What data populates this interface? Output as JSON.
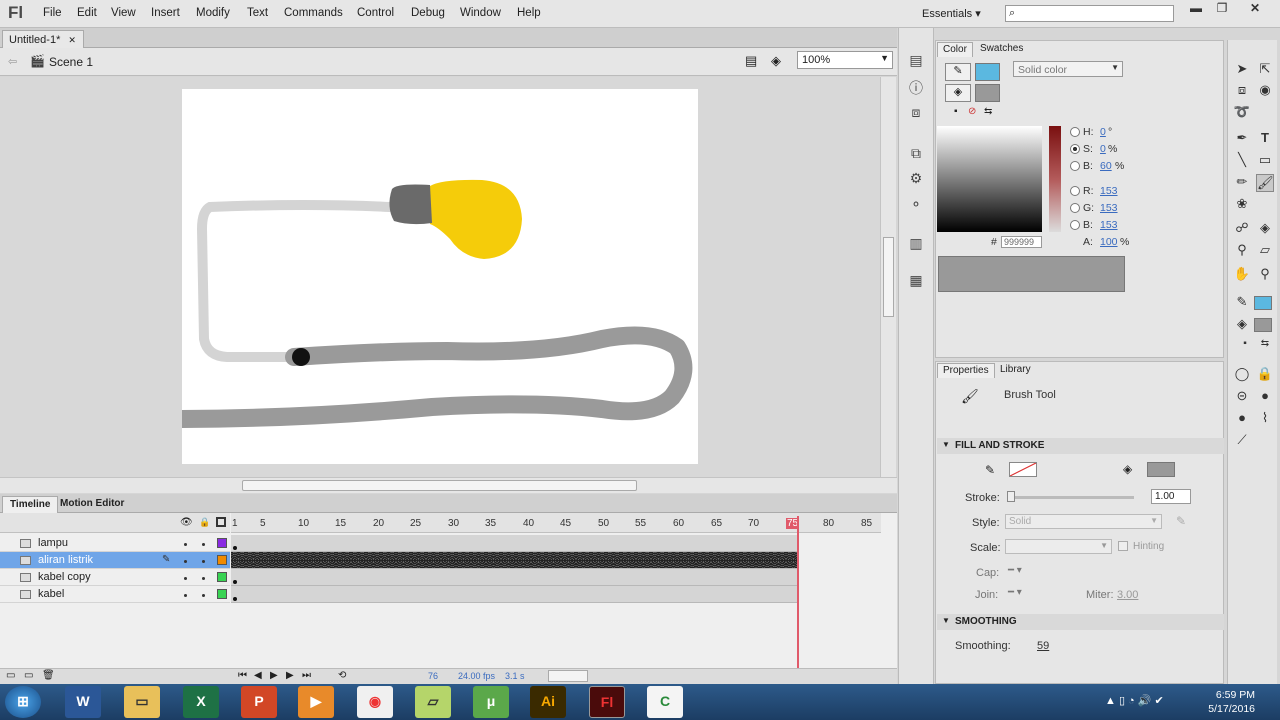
{
  "app": {
    "logo": "Fl"
  },
  "menu": [
    "File",
    "Edit",
    "View",
    "Insert",
    "Modify",
    "Text",
    "Commands",
    "Control",
    "Debug",
    "Window",
    "Help"
  ],
  "workspace": "Essentials",
  "document": {
    "tab": "Untitled-1*",
    "scene": "Scene 1",
    "zoom": "100%"
  },
  "timeline": {
    "tabs": [
      "Timeline",
      "Motion Editor"
    ],
    "frame_numbers": [
      "1",
      "5",
      "10",
      "15",
      "20",
      "25",
      "30",
      "35",
      "40",
      "45",
      "50",
      "55",
      "60",
      "65",
      "70",
      "75",
      "80",
      "85"
    ],
    "current_frame": "76",
    "fps": "24.00 fps",
    "time": "3.1 s",
    "layers": [
      {
        "name": "lampu",
        "color": "#8a2be2"
      },
      {
        "name": "aliran listrik",
        "color": "#f08a00",
        "selected": true
      },
      {
        "name": "kabel copy",
        "color": "#39d353"
      },
      {
        "name": "kabel",
        "color": "#39d353"
      }
    ]
  },
  "color_panel": {
    "tabs": [
      "Color",
      "Swatches"
    ],
    "fill_type": "Solid color",
    "hsb": [
      {
        "label": "H:",
        "value": "0",
        "unit": "°"
      },
      {
        "label": "S:",
        "value": "0",
        "unit": "%"
      },
      {
        "label": "B:",
        "value": "60",
        "unit": "%"
      }
    ],
    "rgb": [
      {
        "label": "R:",
        "value": "153"
      },
      {
        "label": "G:",
        "value": "153"
      },
      {
        "label": "B:",
        "value": "153"
      }
    ],
    "alpha": {
      "label": "A:",
      "value": "100",
      "unit": "%"
    },
    "hex_label": "#",
    "hex": "999999",
    "stroke_swatch": "#5bb8e0",
    "fill_swatch": "#999999"
  },
  "properties": {
    "tabs": [
      "Properties",
      "Library"
    ],
    "tool": "Brush Tool",
    "fill_stroke_header": "FILL AND STROKE",
    "stroke_label": "Stroke:",
    "stroke_value": "1.00",
    "style_label": "Style:",
    "style_value": "Solid",
    "scale_label": "Scale:",
    "hinting": "Hinting",
    "cap_label": "Cap:",
    "join_label": "Join:",
    "miter_label": "Miter:",
    "miter_value": "3.00",
    "smoothing_header": "SMOOTHING",
    "smoothing_label": "Smoothing:",
    "smoothing_value": "59"
  },
  "taskbar": {
    "time": "6:59 PM",
    "date": "5/17/2016"
  }
}
